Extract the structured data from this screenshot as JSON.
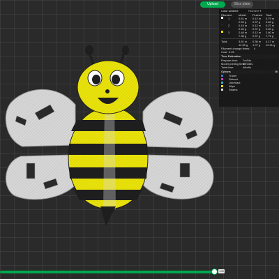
{
  "toolbar": {
    "upload_label": "Upload",
    "slice_label": "Slice plate"
  },
  "panel": {
    "title": "Color scheme",
    "scheme_selected": "Filament",
    "columns": [
      "Filament",
      "Model",
      "Flushed",
      "Total"
    ],
    "filaments": [
      {
        "id": "1",
        "color": "#f2f2f2",
        "model_m": "0.61 m",
        "model_g": "2.59 g",
        "flushed_m": "0.12 m",
        "flushed_g": "0.37 g",
        "total_m": "0.79 m",
        "total_g": "0.83 g"
      },
      {
        "id": "2",
        "color": "#222222",
        "model_m": "0.15 m",
        "model_g": "0.45 g",
        "flushed_m": "0.12 m",
        "flushed_g": "0.37 g",
        "total_m": "0.27 m",
        "total_g": "0.83 g"
      },
      {
        "id": "3",
        "color": "#e8e000",
        "model_m": "2.48 m",
        "model_g": "7.38 g",
        "flushed_m": "0.12 m",
        "flushed_g": "0.37 g",
        "total_m": "2.60 m",
        "total_g": "7.75 g"
      }
    ],
    "total": {
      "label": "Total",
      "model_m": "3.81 m",
      "model_g": "11.35 g",
      "flushed_m": "0.36 m",
      "flushed_g": "1.07 g",
      "total_m": "4.17 m",
      "total_g": "12.41 g"
    },
    "change_times_label": "Filament change times:",
    "change_times": "4",
    "cost_label": "Cost:",
    "cost": "0.25",
    "time_title": "Time Estimation",
    "prepare_label": "Prepare time:",
    "prepare_value": "7m34s",
    "model_time_label": "Model printing time:",
    "model_time_value": "49m35s",
    "total_time_label": "Total time:",
    "total_time_value": "48m9s",
    "options_title": "Options",
    "options_right": "Bl",
    "options": [
      {
        "label": "Travel",
        "color": "#3a7bd5"
      },
      {
        "label": "Retract",
        "color": "#c03cc0"
      },
      {
        "label": "Unretract",
        "color": "#3ab0d5"
      },
      {
        "label": "Wipe",
        "color": "#e8e000"
      },
      {
        "label": "Seams",
        "color": "#e0e0e0"
      }
    ]
  },
  "slider": {
    "label": "195",
    "fraction": 0.78
  },
  "colors": {
    "accent": "#00a84f",
    "bee_yellow": "#e8e000",
    "bee_black": "#1e1e1e",
    "wing_gray": "#d2d2d2"
  }
}
